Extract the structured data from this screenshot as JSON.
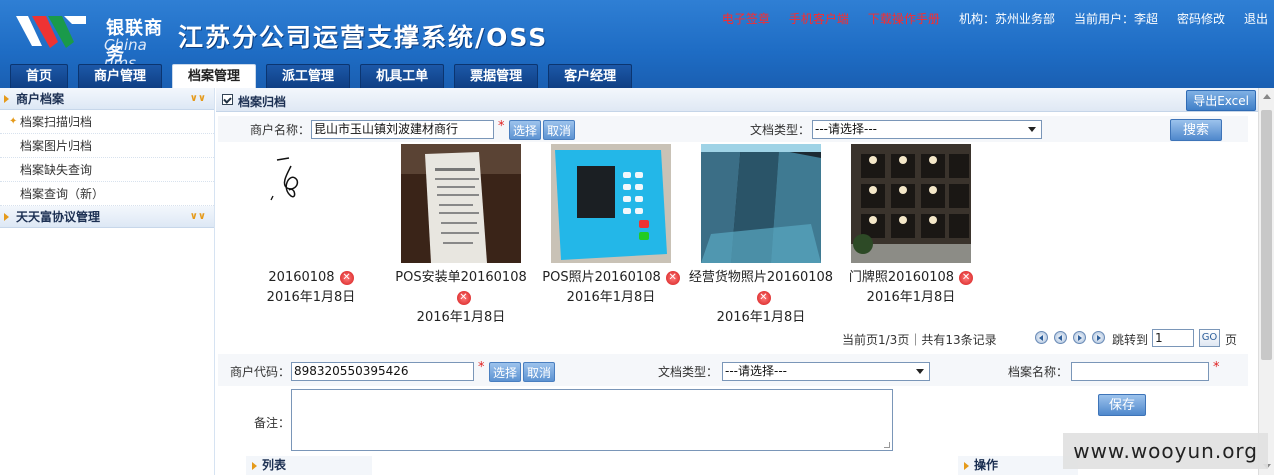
{
  "header": {
    "logo": {
      "cn": "银联商务",
      "en": "China ums"
    },
    "title": "江苏分公司运营支撑系统/OSS",
    "links": {
      "esign": "电子签章",
      "mobile_client": "手机客户端",
      "manual": "下载操作手册",
      "org": "机构：苏州业务部",
      "user": "当前用户：李超",
      "change_password": "密码修改",
      "logout": "退出"
    },
    "tabs": [
      "首页",
      "商户管理",
      "档案管理",
      "派工管理",
      "机具工单",
      "票据管理",
      "客户经理"
    ],
    "active_tab": "档案管理"
  },
  "sidebar": {
    "section1": "商户档案",
    "items": [
      "档案扫描归档",
      "档案图片归档",
      "档案缺失查询",
      "档案查询（新）"
    ],
    "section2": "天天富协议管理"
  },
  "main": {
    "panel_title": "档案归档",
    "export_label": "导出Excel",
    "search": {
      "merchant_label": "商户名称：",
      "merchant_value": "昆山市玉山镇刘波建材商行",
      "select_btn": "选择",
      "cancel_btn": "取消",
      "doctype_label": "文档类型：",
      "doctype_value": "---请选择---",
      "search_btn": "搜索"
    },
    "documents": [
      {
        "name": "20160108",
        "date": "2016年1月8日",
        "kind": "signature"
      },
      {
        "name": "POS安装单20160108",
        "date": "2016年1月8日",
        "kind": "receipt"
      },
      {
        "name": "POS照片20160108",
        "date": "2016年1月8日",
        "kind": "pos"
      },
      {
        "name": "经营货物照片20160108",
        "date": "2016年1月8日",
        "kind": "shelf"
      },
      {
        "name": "门牌照20160108",
        "date": "2016年1月8日",
        "kind": "store"
      }
    ],
    "pager": {
      "info": "当前页1/3页｜共有13条记录",
      "jump_label": "跳转到",
      "page_value": "1",
      "go": "GO",
      "page_suffix": "页"
    },
    "form": {
      "code_label": "商户代码：",
      "code_value": "898320550395426",
      "select_btn": "选择",
      "cancel_btn": "取消",
      "doctype_label": "文档类型：",
      "doctype_value": "---请选择---",
      "name_label": "档案名称：",
      "name_value": "",
      "remark_label": "备注：",
      "save_btn": "保存"
    },
    "lists": {
      "list_title": "列表",
      "ops_title": "操作"
    }
  },
  "watermark": "www.wooyun.org",
  "colors": {
    "header_blue": "#1e6cc4",
    "tab_dark": "#0f3f84",
    "link_red": "#ff2a2a",
    "accent_orange": "#e59a1a"
  }
}
